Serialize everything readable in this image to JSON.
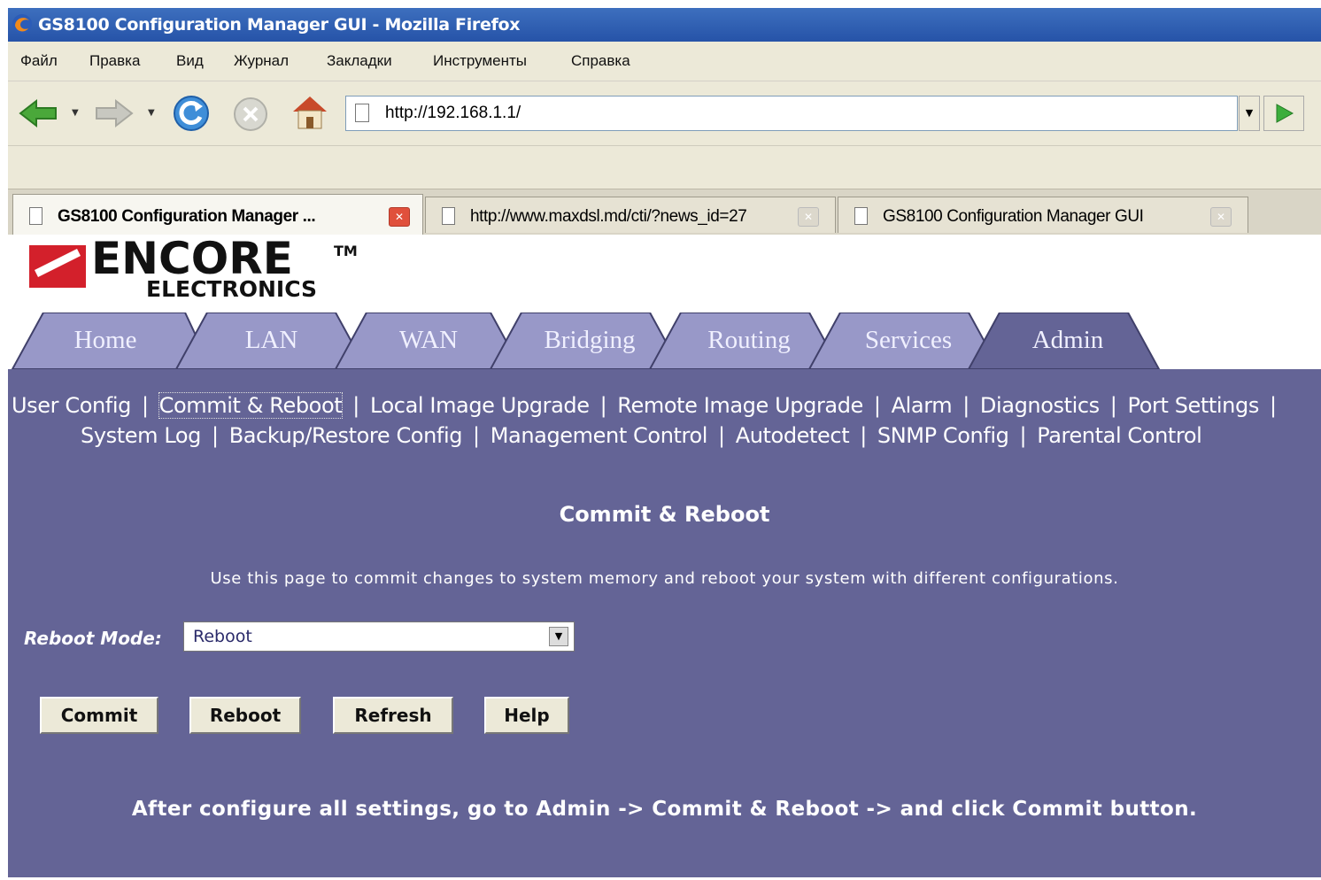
{
  "window": {
    "title": "GS8100 Configuration Manager GUI - Mozilla Firefox"
  },
  "menu": [
    "Файл",
    "Правка",
    "Вид",
    "Журнал",
    "Закладки",
    "Инструменты",
    "Справка"
  ],
  "toolbar": {
    "url": "http://192.168.1.1/"
  },
  "tabs": [
    {
      "label": "GS8100 Configuration Manager ...",
      "active": true
    },
    {
      "label": "http://www.maxdsl.md/cti/?news_id=27",
      "active": false
    },
    {
      "label": "GS8100 Configuration Manager GUI",
      "active": false
    }
  ],
  "logo": {
    "brand": "ENCORE",
    "tm": "TM",
    "sub": "ELECTRONICS"
  },
  "nav": {
    "tabs": [
      "Home",
      "LAN",
      "WAN",
      "Bridging",
      "Routing",
      "Services",
      "Admin"
    ],
    "active": "Admin"
  },
  "sublinks": {
    "row1": [
      "User Config",
      "Commit & Reboot",
      "Local Image Upgrade",
      "Remote Image Upgrade",
      "Alarm",
      "Diagnostics",
      "Port Settings"
    ],
    "row2": [
      "System Log",
      "Backup/Restore Config",
      "Management Control",
      "Autodetect",
      "SNMP Config",
      "Parental Control"
    ],
    "separator": "|"
  },
  "page": {
    "title": "Commit & Reboot",
    "description": "Use this page to commit changes to system memory and reboot your system with different configurations.",
    "reboot_mode_label": "Reboot Mode:",
    "reboot_mode_value": "Reboot",
    "buttons": {
      "commit": "Commit",
      "reboot": "Reboot",
      "refresh": "Refresh",
      "help": "Help"
    },
    "note": "After configure all settings, go to Admin -> Commit & Reboot -> and click Commit button."
  },
  "colors": {
    "content_bg": "#646496",
    "nav_tab": "#9898c8",
    "nav_tab_active": "#646496",
    "title_bar": "#2653a8"
  }
}
